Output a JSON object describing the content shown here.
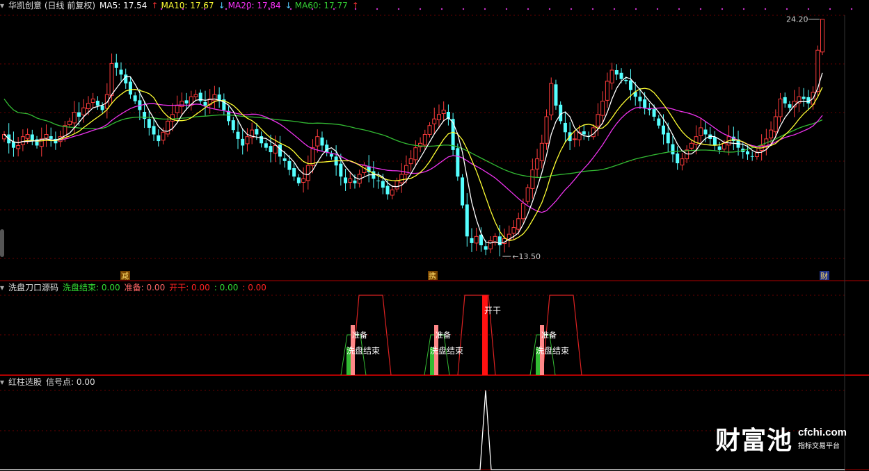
{
  "panels": {
    "main": {
      "title": "华凯创意 (日线 前复权)",
      "ma": [
        {
          "label": "MA5: 17.54",
          "arrow": "↑",
          "color": "#ffffff"
        },
        {
          "label": "MA10: 17.67",
          "arrow": "↓",
          "color": "#ffff33"
        },
        {
          "label": "MA20: 17.84",
          "arrow": "↓",
          "color": "#ff33ff"
        },
        {
          "label": "MA60: 17.77",
          "arrow": "↑",
          "color": "#33cc33"
        }
      ],
      "high_label": "24.20",
      "low_label": "13.50",
      "markers": [
        {
          "text": "减",
          "x": 180
        },
        {
          "text": "携",
          "x": 622
        },
        {
          "text": "财",
          "x": 1185
        }
      ]
    },
    "sub1": {
      "title": "洗盘刀口源码",
      "values": [
        {
          "label": "洗盘结束: 0.00",
          "color": "#33dd33"
        },
        {
          "label": "准备: 0.00",
          "color": "#ff6666"
        },
        {
          "label": "开干: 0.00",
          "color": "#ff2222"
        },
        {
          "label": ": 0.00",
          "color": "#33dd33"
        },
        {
          "label": ": 0.00",
          "color": "#ff2222"
        }
      ],
      "annotations": [
        "准备",
        "洗盘结束",
        "开干"
      ]
    },
    "sub2": {
      "title": "红柱选股",
      "value": "信号点: 0.00"
    }
  },
  "colors": {
    "up": "#ff3c3c",
    "down": "#55ffff",
    "ma5": "#ffffff",
    "ma10": "#ffff33",
    "ma20": "#ee33ee",
    "ma60": "#33bb33",
    "grid": "#6a0000",
    "axis": "#b00000"
  },
  "watermark": {
    "cn": "财富池",
    "url": "cfchi.com",
    "sub": "指标交易平台"
  },
  "chart_data": {
    "type": "candlestick",
    "ylim": [
      13.0,
      24.5
    ],
    "high": 24.2,
    "low": 13.5,
    "closes": [
      19.0,
      18.6,
      18.4,
      18.5,
      18.9,
      19.0,
      18.7,
      18.5,
      18.8,
      19.0,
      18.8,
      18.6,
      18.9,
      19.4,
      19.6,
      20.0,
      19.8,
      20.2,
      20.4,
      20.6,
      20.3,
      20.1,
      20.8,
      22.2,
      22.0,
      21.7,
      21.3,
      20.8,
      20.5,
      20.1,
      19.7,
      19.3,
      19.0,
      18.7,
      19.1,
      19.6,
      19.9,
      20.3,
      20.5,
      20.4,
      20.7,
      20.8,
      20.5,
      20.3,
      20.6,
      20.8,
      20.5,
      20.1,
      19.6,
      19.2,
      18.8,
      18.5,
      18.9,
      19.2,
      19.0,
      18.6,
      18.4,
      18.2,
      18.5,
      18.0,
      17.8,
      17.4,
      17.1,
      16.8,
      17.0,
      17.6,
      18.4,
      18.9,
      18.5,
      18.2,
      18.0,
      17.6,
      17.1,
      16.8,
      17.0,
      16.8,
      17.2,
      17.6,
      17.3,
      17.0,
      16.9,
      16.6,
      16.3,
      16.5,
      16.9,
      17.2,
      17.6,
      17.9,
      18.4,
      18.6,
      19.0,
      19.4,
      19.7,
      19.9,
      20.1,
      19.7,
      18.3,
      17.1,
      15.8,
      14.4,
      14.1,
      14.4,
      14.0,
      13.8,
      14.2,
      14.4,
      14.0,
      14.3,
      14.5,
      14.8,
      15.2,
      15.9,
      16.6,
      17.4,
      17.9,
      18.6,
      19.8,
      21.3,
      20.3,
      19.6,
      19.1,
      18.7,
      18.8,
      19.1,
      19.0,
      18.9,
      19.3,
      19.9,
      20.5,
      21.4,
      21.9,
      21.7,
      21.5,
      21.4,
      21.0,
      20.7,
      20.5,
      20.2,
      20.1,
      19.8,
      19.4,
      19.0,
      18.6,
      18.1,
      17.7,
      17.9,
      18.3,
      18.6,
      18.9,
      19.3,
      19.0,
      18.8,
      18.5,
      18.3,
      18.6,
      18.9,
      18.7,
      18.4,
      18.2,
      18.1,
      18.0,
      18.2,
      18.5,
      18.8,
      19.2,
      19.8,
      20.6,
      20.4,
      20.2,
      20.5,
      20.7,
      20.6,
      20.4,
      20.9,
      22.8,
      24.2
    ]
  }
}
